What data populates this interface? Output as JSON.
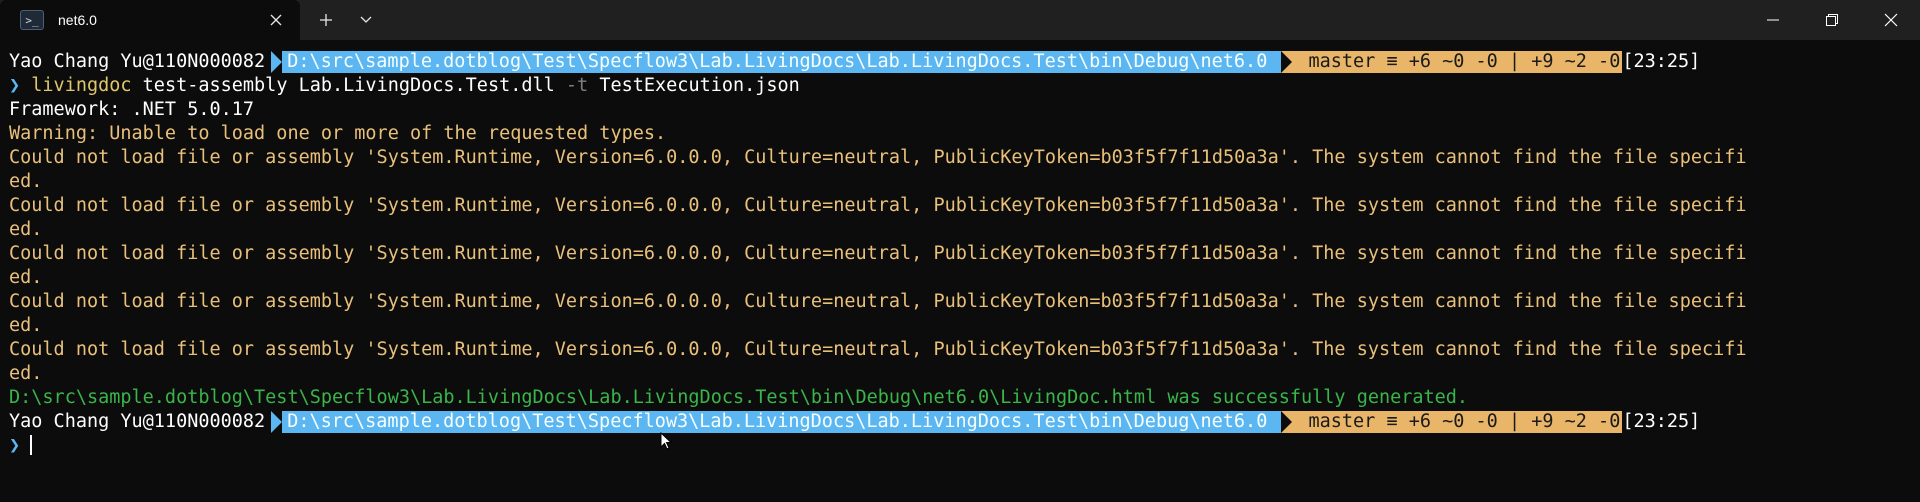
{
  "window": {
    "tab_title": "net6.0",
    "tab_icon": "powershell-icon",
    "new_tab_label": "+",
    "close_tab_glyph": "✕",
    "dropdown_glyph": "⌄",
    "controls": {
      "minimize": "—",
      "maximize": "❐",
      "close": "✕"
    }
  },
  "prompt": {
    "user": "Yao Chang Yu@110N000082",
    "path": "D:\\src\\sample.dotblog\\Test\\Specflow3\\Lab.LivingDocs\\Lab.LivingDocs.Test\\bin\\Debug\\net6.0",
    "git": " master ≡ +6 ~0 -0 | +9 ~2 -0",
    "git_icon": "",
    "time": "[23:25]",
    "arrow": "❯"
  },
  "command": {
    "program": "livingdoc",
    "part1": " test-assembly Lab.LivingDocs.Test.dll ",
    "flag": "-t",
    "part2": " TestExecution.json"
  },
  "output": {
    "framework": "Framework: .NET 5.0.17",
    "warning": "Warning: Unable to load one or more of the requested types.",
    "errors": [
      {
        "line": "Could not load file or assembly 'System.Runtime, Version=6.0.0.0, Culture=neutral, PublicKeyToken=b03f5f7f11d50a3a'. The system cannot find the file specifi",
        "wrap": "ed."
      },
      {
        "line": "Could not load file or assembly 'System.Runtime, Version=6.0.0.0, Culture=neutral, PublicKeyToken=b03f5f7f11d50a3a'. The system cannot find the file specifi",
        "wrap": "ed."
      },
      {
        "line": "Could not load file or assembly 'System.Runtime, Version=6.0.0.0, Culture=neutral, PublicKeyToken=b03f5f7f11d50a3a'. The system cannot find the file specifi",
        "wrap": "ed."
      },
      {
        "line": "Could not load file or assembly 'System.Runtime, Version=6.0.0.0, Culture=neutral, PublicKeyToken=b03f5f7f11d50a3a'. The system cannot find the file specifi",
        "wrap": "ed."
      },
      {
        "line": "Could not load file or assembly 'System.Runtime, Version=6.0.0.0, Culture=neutral, PublicKeyToken=b03f5f7f11d50a3a'. The system cannot find the file specifi",
        "wrap": "ed."
      }
    ],
    "success": "D:\\src\\sample.dotblog\\Test\\Specflow3\\Lab.LivingDocs\\Lab.LivingDocs.Test\\bin\\Debug\\net6.0\\LivingDoc.html was successfully generated."
  },
  "colors": {
    "background": "#0c0c0c",
    "titlebar": "#202020",
    "path_segment": "#5cb6f2",
    "git_segment": "#e9b569",
    "warning_text": "#e9c07a",
    "success_text": "#39b54a"
  }
}
